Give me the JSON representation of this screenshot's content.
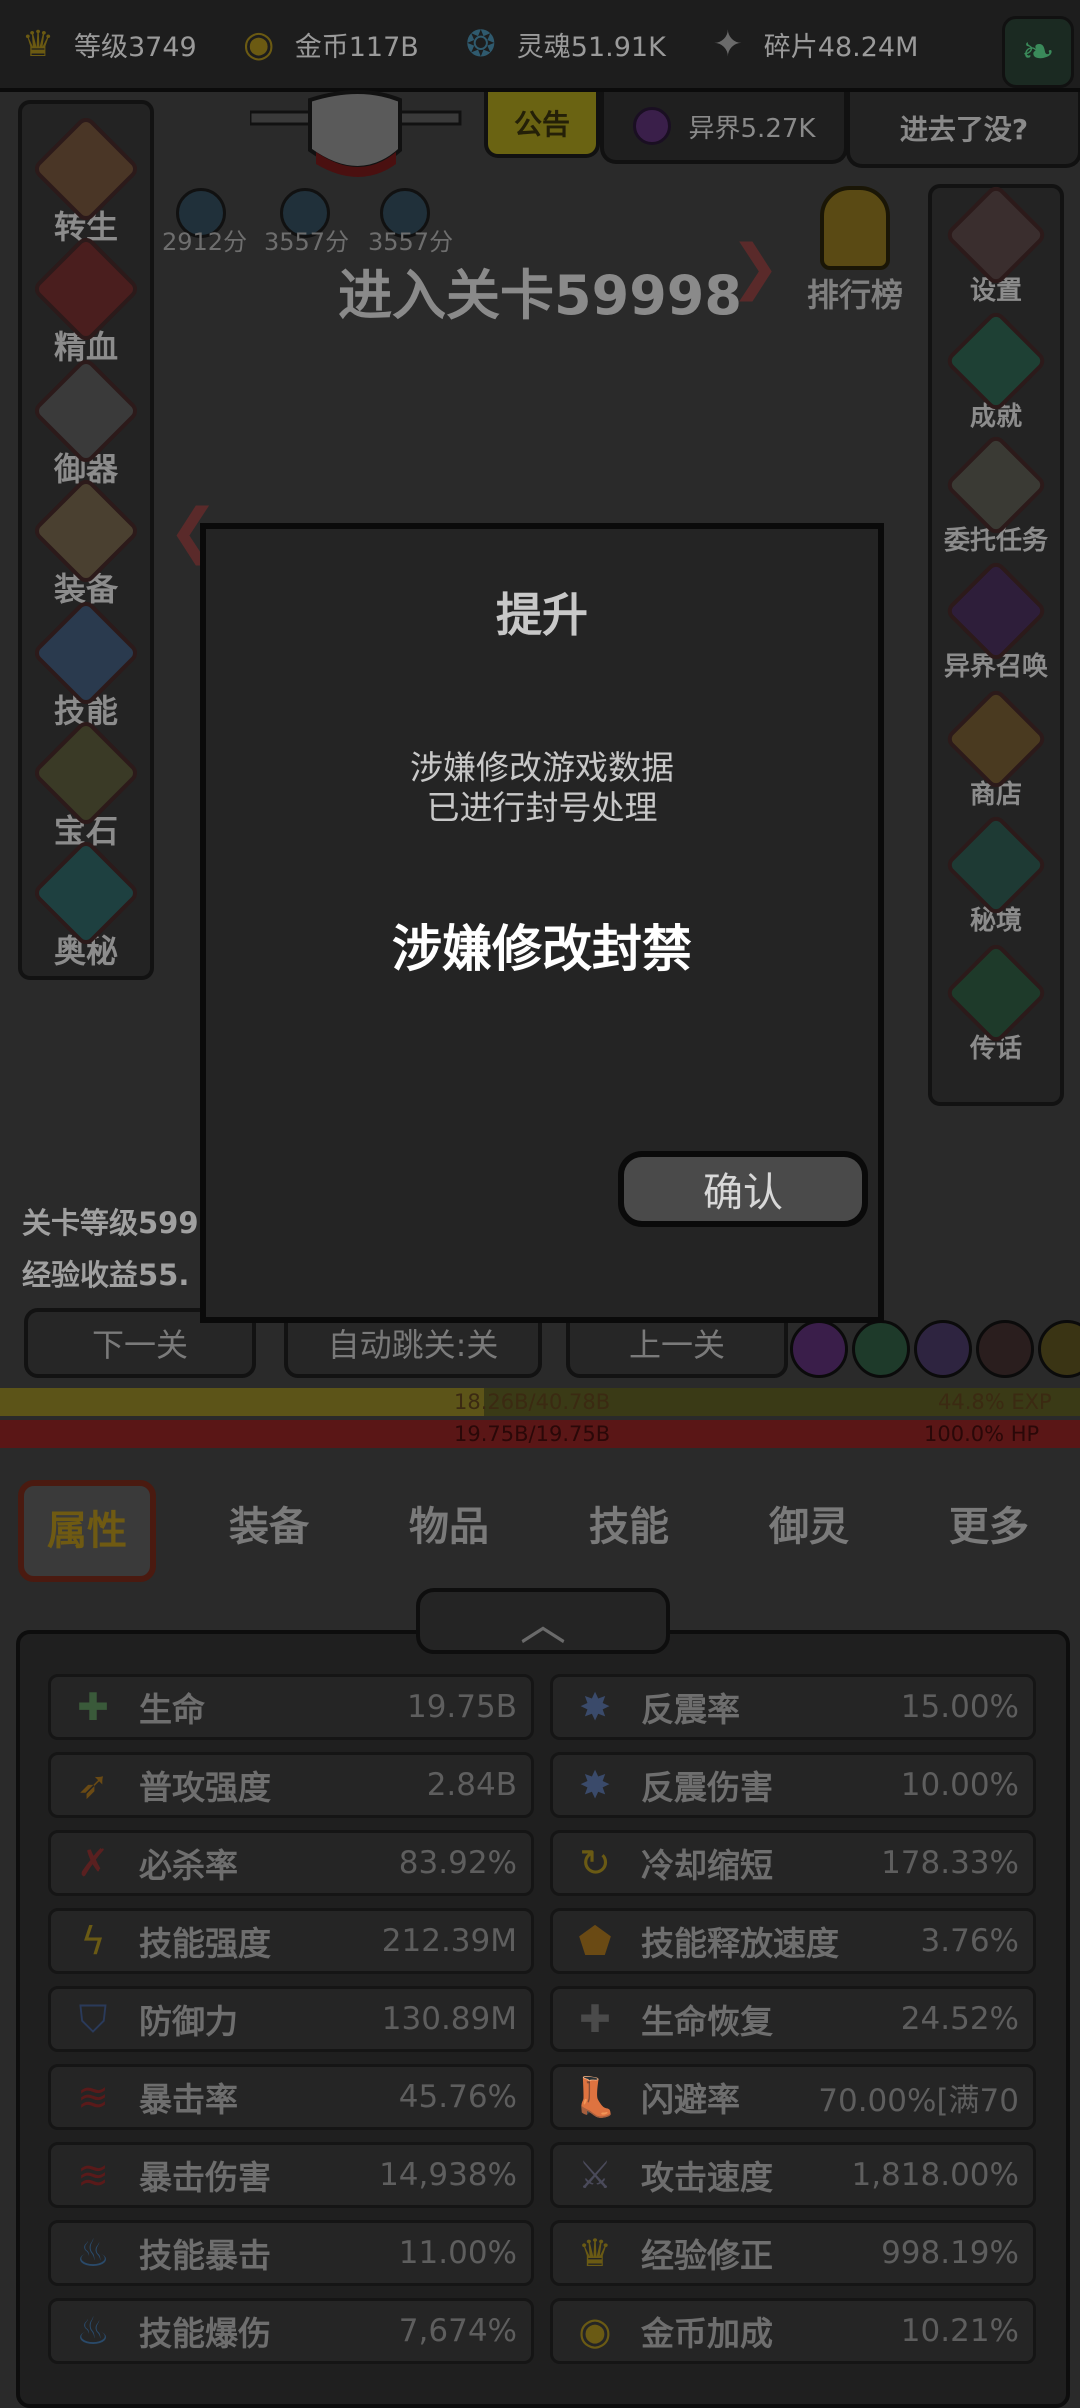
{
  "topbar": {
    "resources": [
      {
        "name": "level",
        "icon": "crown-icon",
        "text": "等级3749",
        "color": "#6b5a12"
      },
      {
        "name": "gold",
        "icon": "coin-icon",
        "text": "金币117B",
        "color": "#6b5a12"
      },
      {
        "name": "soul",
        "icon": "soul-flame-icon",
        "text": "灵魂51.91K",
        "color": "#2f5a6e"
      },
      {
        "name": "shard",
        "icon": "shard-icon",
        "text": "碎片48.24M",
        "color": "#6a6a6a"
      }
    ]
  },
  "notice": {
    "label": "公告"
  },
  "otherworld": {
    "text": "异界5.27K"
  },
  "gotin": {
    "label": "进去了没?"
  },
  "left_menu": [
    {
      "label": "转生",
      "icon": "rebirth-icon"
    },
    {
      "label": "精血",
      "icon": "blood-icon"
    },
    {
      "label": "御器",
      "icon": "artifact-icon"
    },
    {
      "label": "装备",
      "icon": "armor-icon"
    },
    {
      "label": "技能",
      "icon": "skill-flame-icon"
    },
    {
      "label": "宝石",
      "icon": "gem-bag-icon"
    },
    {
      "label": "奥秘",
      "icon": "mystery-icon"
    }
  ],
  "right_menu": [
    {
      "label": "设置",
      "icon": "gear-icon"
    },
    {
      "label": "成就",
      "icon": "star-icon"
    },
    {
      "label": "委托任务",
      "icon": "scroll-icon"
    },
    {
      "label": "异界召唤",
      "icon": "portal-icon"
    },
    {
      "label": "商店",
      "icon": "shop-bag-icon"
    },
    {
      "label": "秘境",
      "icon": "secret-realm-icon"
    },
    {
      "label": "传话",
      "icon": "horn-icon"
    }
  ],
  "scores": [
    "2912分",
    "3557分",
    "3557分"
  ],
  "stage": {
    "title": "进入关卡59998"
  },
  "ranking": {
    "label": "排行榜"
  },
  "dialog": {
    "title": "提升",
    "line1": "涉嫌修改游戏数据",
    "line2": "已进行封号处理",
    "ban": "涉嫌修改封禁",
    "confirm": "确认"
  },
  "stage_stats": {
    "level": "关卡等级599",
    "exp": "经验收益55."
  },
  "nav": {
    "next": "下一关",
    "auto": "自动跳关:关",
    "prev": "上一关"
  },
  "exp_bar": {
    "value": "18.26B/40.78B",
    "percent": "44.8% EXP",
    "fill": 0.448
  },
  "hp_bar": {
    "value": "19.75B/19.75B",
    "percent": "100.0%   HP",
    "fill": 1.0
  },
  "tabs": [
    "属性",
    "装备",
    "物品",
    "技能",
    "御灵",
    "更多"
  ],
  "attributes_left": [
    {
      "name": "生命",
      "value": "19.75B",
      "icon": "life-cross-icon",
      "color": "#3a5a3a"
    },
    {
      "name": "普攻强度",
      "value": "2.84B",
      "icon": "arrow-icon",
      "color": "#6a4a14"
    },
    {
      "name": "必杀率",
      "value": "83.92%",
      "icon": "crit-slash-icon",
      "color": "#5a2020"
    },
    {
      "name": "技能强度",
      "value": "212.39M",
      "icon": "lightning-icon",
      "color": "#6a5a14"
    },
    {
      "name": "防御力",
      "value": "130.89M",
      "icon": "shield-icon",
      "color": "#2a3a5a"
    },
    {
      "name": "暴击率",
      "value": "45.76%",
      "icon": "claw-icon",
      "color": "#5a1a1a"
    },
    {
      "name": "暴击伤害",
      "value": "14,938%",
      "icon": "claw-icon",
      "color": "#5a1a1a"
    },
    {
      "name": "技能暴击",
      "value": "11.00%",
      "icon": "blue-flame-icon",
      "color": "#2a4a6a"
    },
    {
      "name": "技能爆伤",
      "value": "7,674%",
      "icon": "blue-flame-icon",
      "color": "#2a4a6a"
    }
  ],
  "attributes_right": [
    {
      "name": "反震率",
      "value": "15.00%",
      "icon": "spark-icon",
      "color": "#3a4a6a"
    },
    {
      "name": "反震伤害",
      "value": "10.00%",
      "icon": "spark-icon",
      "color": "#3a4a6a"
    },
    {
      "name": "冷却缩短",
      "value": "178.33%",
      "icon": "cooldown-icon",
      "color": "#6a5a14"
    },
    {
      "name": "技能释放速度",
      "value": "3.76%",
      "icon": "fire-badge-icon",
      "color": "#6a4a14"
    },
    {
      "name": "生命恢复",
      "value": "24.52%",
      "icon": "heal-icon",
      "color": "#4a4a4a"
    },
    {
      "name": "闪避率",
      "value": "70.00%[满70",
      "icon": "boot-icon",
      "color": "#6a5a24"
    },
    {
      "name": "攻击速度",
      "value": "1,818.00%",
      "icon": "sword-icon",
      "color": "#4a4a5a"
    },
    {
      "name": "经验修正",
      "value": "998.19%",
      "icon": "crown-icon",
      "color": "#6a5a14"
    },
    {
      "name": "金币加成",
      "value": "10.21%",
      "icon": "coin-icon",
      "color": "#6a5a14"
    }
  ]
}
